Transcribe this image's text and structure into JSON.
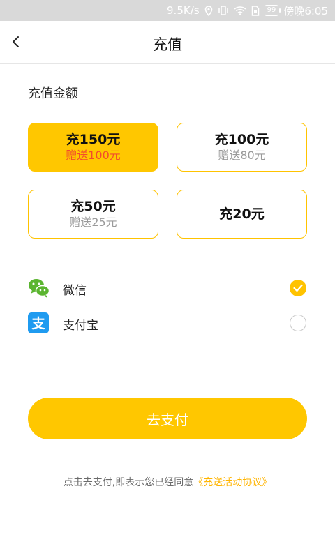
{
  "status_bar": {
    "speed": "9.5K/s",
    "battery": "99",
    "time": "傍晚6:05"
  },
  "header": {
    "title": "充值"
  },
  "recharge": {
    "section_label": "充值金额",
    "options": [
      {
        "main": "充150元",
        "bonus": "赠送100元"
      },
      {
        "main": "充100元",
        "bonus": "赠送80元"
      },
      {
        "main": "充50元",
        "bonus": "赠送25元"
      },
      {
        "main": "充20元",
        "bonus": ""
      }
    ],
    "selected_index": 0
  },
  "payment": {
    "methods": [
      {
        "label": "微信",
        "icon": "wechat-icon",
        "checked": true
      },
      {
        "label": "支付宝",
        "icon": "alipay-icon",
        "checked": false
      }
    ]
  },
  "actions": {
    "pay_label": "去支付"
  },
  "agreement": {
    "text": "点击去支付,即表示您已经同意",
    "link": "《充送活动协议》"
  },
  "colors": {
    "accent": "#ffc700",
    "bonus_red": "#f24b2c",
    "link": "#ffb400",
    "wechat": "#5bb530",
    "alipay": "#1f9bf0"
  }
}
